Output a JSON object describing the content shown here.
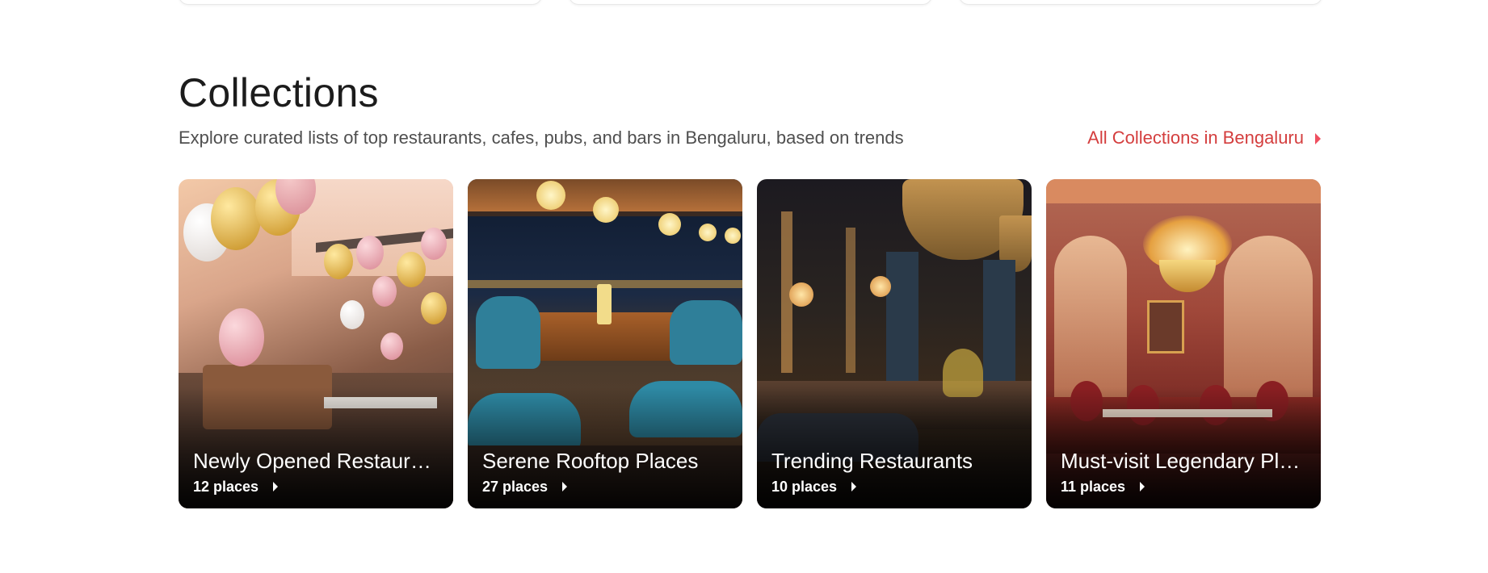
{
  "collections": {
    "title": "Collections",
    "subtitle": "Explore curated lists of top restaurants, cafes, pubs, and bars in Bengaluru, based on trends",
    "all_link_label": "All Collections in Bengaluru",
    "cards": [
      {
        "title": "Newly Opened Restaurants",
        "count": "12 places"
      },
      {
        "title": "Serene Rooftop Places",
        "count": "27 places"
      },
      {
        "title": "Trending Restaurants",
        "count": "10 places"
      },
      {
        "title": "Must-visit Legendary Places",
        "count": "11 places"
      }
    ]
  },
  "colors": {
    "accent": "#ef4f5f",
    "link": "#d43e3e",
    "title": "#1c1c1c",
    "subtitle": "#4f4f4f"
  },
  "icons": {
    "link_caret": "caret-right-icon",
    "card_caret": "caret-right-icon"
  }
}
